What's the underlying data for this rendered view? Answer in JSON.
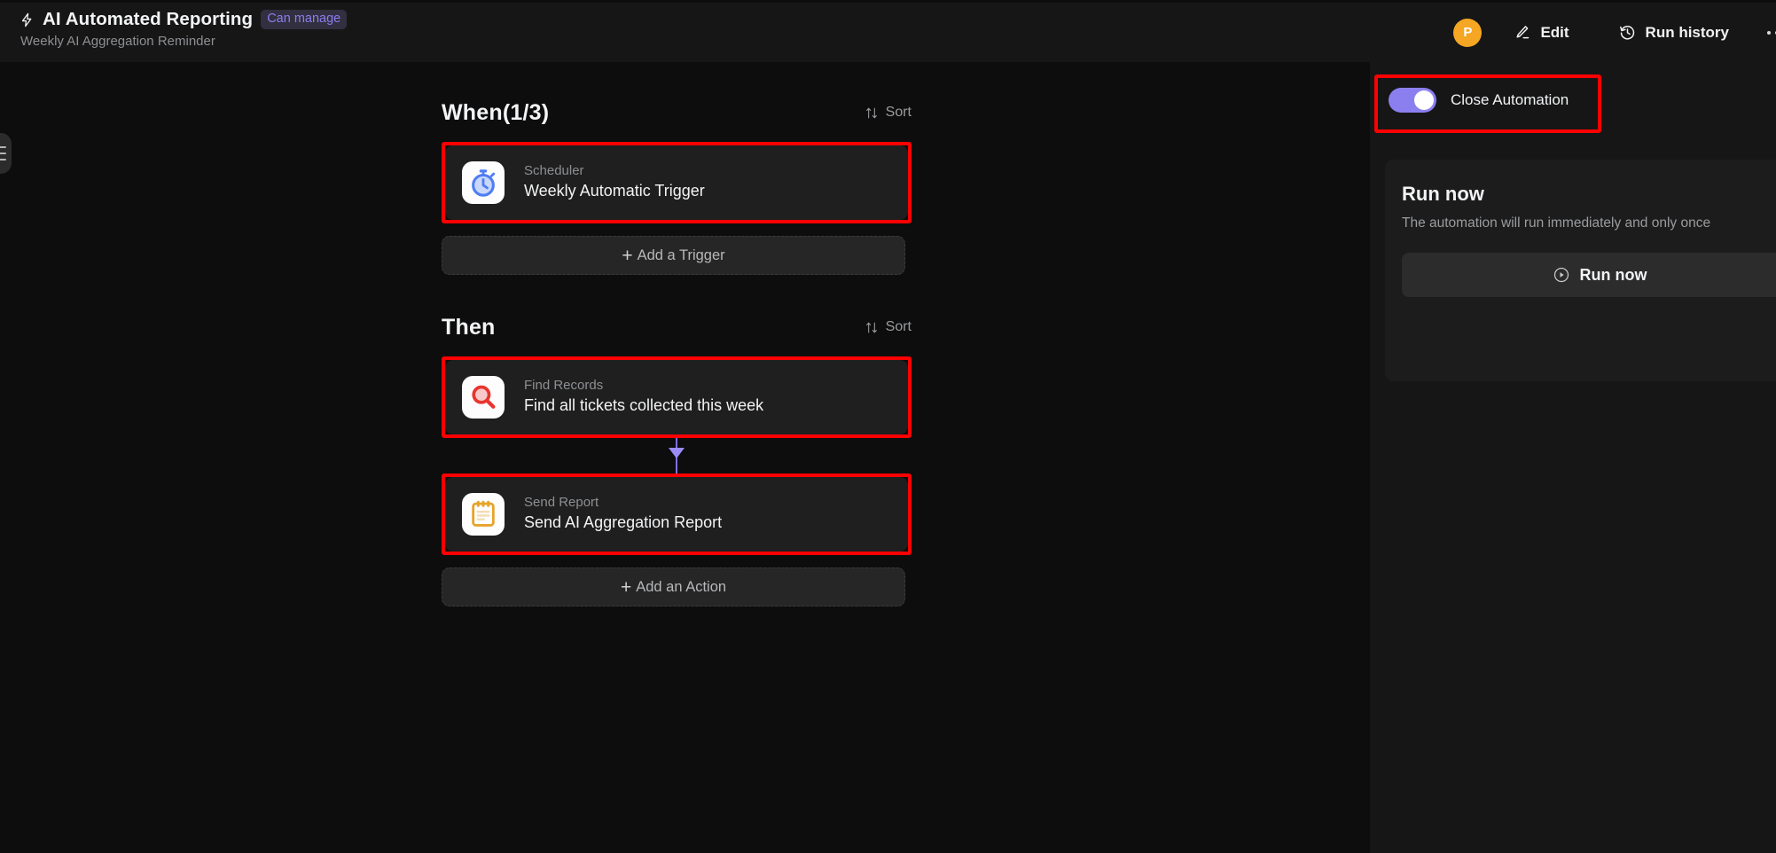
{
  "header": {
    "bolt_icon": "bolt-icon",
    "title": "AI Automated Reporting",
    "permission_badge": "Can manage",
    "subtitle": "Weekly AI Aggregation Reminder",
    "avatar_initial": "P",
    "edit_label": "Edit",
    "run_history_label": "Run history",
    "overflow_label": "More options"
  },
  "flow": {
    "when": {
      "title": "When(1/3)",
      "sort_label": "Sort",
      "card": {
        "icon": "stopwatch-icon",
        "kind": "Scheduler",
        "name": "Weekly Automatic Trigger"
      },
      "add_label": "Add a Trigger",
      "add_plus": "+"
    },
    "then": {
      "title": "Then",
      "sort_label": "Sort",
      "cards": [
        {
          "icon": "magnifier-icon",
          "kind": "Find Records",
          "name": "Find all tickets collected this week"
        },
        {
          "icon": "clipboard-icon",
          "kind": "Send Report",
          "name": "Send AI Aggregation Report"
        }
      ],
      "add_label": "Add an Action",
      "add_plus": "+"
    }
  },
  "right_panel": {
    "toggle_label": "Close Automation",
    "toggle_on": true,
    "run_now": {
      "title": "Run now",
      "description": "The automation will run immediately and only once",
      "button_label": "Run now",
      "button_icon": "play-circle-icon"
    }
  },
  "colors": {
    "accent_purple": "#8b7ff0",
    "badge_text": "#8b7dee",
    "avatar": "#f5a623",
    "annotation_red": "#ff0000",
    "connector": "#7f6ef0"
  }
}
